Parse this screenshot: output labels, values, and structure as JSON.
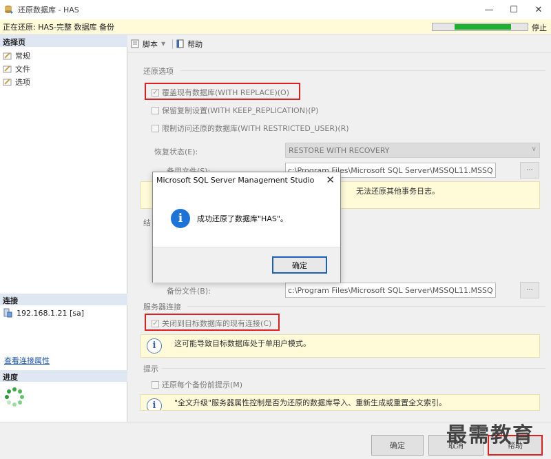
{
  "window": {
    "title": "还原数据库 - HAS"
  },
  "status": {
    "text": "正在还原: HAS-完整 数据库 备份",
    "progress": 0.77,
    "stop_label": "停止"
  },
  "left": {
    "select_page_header": "选择页",
    "pages": [
      {
        "label": "常规"
      },
      {
        "label": "文件"
      },
      {
        "label": "选项"
      }
    ],
    "connection_header": "连接",
    "connection_value": "192.168.1.21 [sa]",
    "view_props_link": "查看连接属性",
    "progress_header": "进度"
  },
  "toolbar": {
    "script_label": "脚本",
    "help_label": "帮助"
  },
  "restore_options": {
    "group_label": "还原选项",
    "overwrite": "覆盖现有数据库(WITH REPLACE)(O)",
    "keep_replication": "保留复制设置(WITH KEEP_REPLICATION)(P)",
    "restricted_user": "限制访问还原的数据库(WITH RESTRICTED_USER)(R)",
    "recovery_state_label": "恢复状态(E):",
    "recovery_state_value": "RESTORE WITH RECOVERY",
    "standby_file_label": "备用文件(S):",
    "standby_file_value": "c:\\Program Files\\Microsoft SQL Server\\MSSQL11.MSSQ",
    "warning_text": "无法还原其他事务日志。"
  },
  "tail_log": {
    "group_label_fragment": "结",
    "backup_file_label": "备份文件(B):",
    "backup_file_value": "c:\\Program Files\\Microsoft SQL Server\\MSSQL11.MSSQ"
  },
  "server_connections": {
    "group_label": "服务器连接",
    "close_connections": "关闭到目标数据库的现有连接(C)",
    "info_text": "这可能导致目标数据库处于单用户模式。"
  },
  "prompt": {
    "group_label": "提示",
    "prompt_before_each": "还原每个备份前提示(M)",
    "info_text": "\"全文升级\"服务器属性控制是否为还原的数据库导入、重新生成或重置全文索引。"
  },
  "bottom_buttons": {
    "ok": "确定",
    "cancel": "取消",
    "help": "帮助"
  },
  "watermark": "最需教育",
  "dialog": {
    "title": "Microsoft SQL Server Management Studio",
    "message": "成功还原了数据库\"HAS\"。",
    "ok_label": "确定"
  },
  "colors": {
    "progress_fill": "#20b030",
    "highlight_frame": "#e02020",
    "info_blue": "#1e73d8"
  }
}
